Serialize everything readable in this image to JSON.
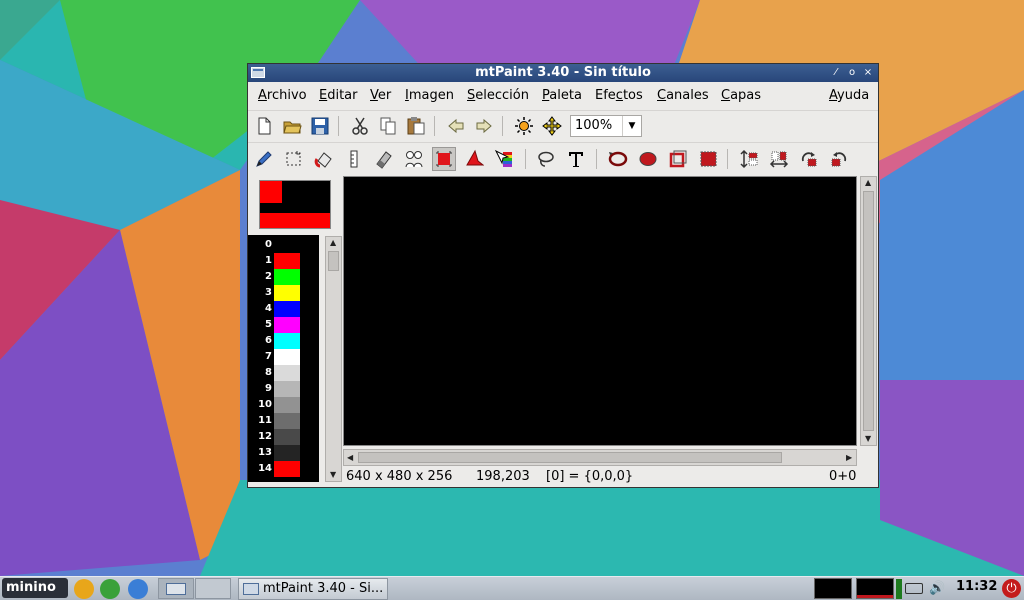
{
  "window": {
    "title": "mtPaint 3.40 - Sin título",
    "controls": [
      "⁄",
      "o",
      "×"
    ]
  },
  "menubar": {
    "items": [
      {
        "label": "Archivo",
        "mnemonic": "A",
        "rest": "rchivo"
      },
      {
        "label": "Editar",
        "mnemonic": "E",
        "rest": "ditar"
      },
      {
        "label": "Ver",
        "mnemonic": "V",
        "rest": "er"
      },
      {
        "label": "Imagen",
        "mnemonic": "I",
        "rest": "magen"
      },
      {
        "label": "Selección",
        "mnemonic": "S",
        "rest": "elección"
      },
      {
        "label": "Paleta",
        "mnemonic": "P",
        "rest": "aleta"
      },
      {
        "label": "Efectos",
        "pre": "Efe",
        "mnemonic": "c",
        "rest": "tos"
      },
      {
        "label": "Canales",
        "mnemonic": "C",
        "rest": "anales"
      },
      {
        "label": "Capas",
        "mnemonic": "C",
        "rest": "apas"
      },
      {
        "label": "Ayuda",
        "mnemonic": "A",
        "rest": "yuda"
      }
    ]
  },
  "toolbar": {
    "zoom_value": "100%"
  },
  "palette": {
    "entries": [
      {
        "index": "0",
        "color": "#000000"
      },
      {
        "index": "1",
        "color": "#ff0000"
      },
      {
        "index": "2",
        "color": "#00ff00"
      },
      {
        "index": "3",
        "color": "#ffff00"
      },
      {
        "index": "4",
        "color": "#0000ff"
      },
      {
        "index": "5",
        "color": "#ff00ff"
      },
      {
        "index": "6",
        "color": "#00ffff"
      },
      {
        "index": "7",
        "color": "#ffffff"
      },
      {
        "index": "8",
        "color": "#dadada"
      },
      {
        "index": "9",
        "color": "#b6b6b6"
      },
      {
        "index": "10",
        "color": "#929292"
      },
      {
        "index": "11",
        "color": "#6d6d6d"
      },
      {
        "index": "12",
        "color": "#494949"
      },
      {
        "index": "13",
        "color": "#242424"
      },
      {
        "index": "14",
        "color": "#ff0000"
      }
    ]
  },
  "status": {
    "geometry": "640 x 480 x 256",
    "cursor": "198,203",
    "pixel": "[0] = {0,0,0}",
    "offset": "0+0"
  },
  "taskbar": {
    "start_label": "minino",
    "task_label": "mtPaint 3.40 - Si...",
    "clock": "11:32"
  },
  "colors": {
    "accent_title": "#28467a",
    "primary": "#ff0000",
    "canvas": "#000000"
  }
}
